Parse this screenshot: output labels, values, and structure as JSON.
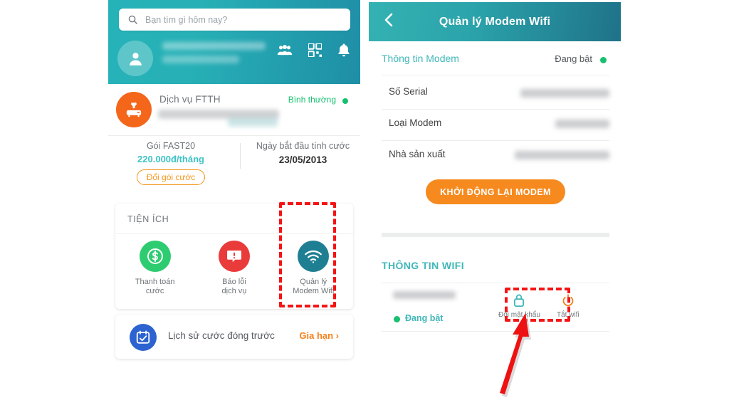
{
  "app": {
    "left_screen": {
      "search": {
        "placeholder": "Bạn tìm gì hôm nay?",
        "value": "",
        "icon": "search-icon"
      },
      "header_icons": [
        {
          "name": "friends-icon",
          "label": "Bạn bè"
        },
        {
          "name": "qr-code-icon",
          "label": "QR"
        },
        {
          "name": "bell-icon",
          "label": "Thông báo"
        }
      ],
      "service": {
        "icon": "modem-icon",
        "title": "Dịch vụ FTTH",
        "status": "Bình thường",
        "status_color": "#17c070"
      },
      "plan": {
        "name": "Gói FAST20",
        "price": "220.000đ/tháng",
        "change_plan_button": "Đổi gói cước",
        "billing_label": "Ngày bắt đầu tính cước",
        "billing_date": "23/05/2013"
      },
      "utilities": {
        "title": "TIỆN ÍCH",
        "items": [
          {
            "label": "Thanh toán\ncước",
            "line1": "Thanh toán",
            "line2": "cước",
            "icon": "dollar-icon",
            "color": "#2ecc71"
          },
          {
            "label": "Báo lỗi\ndịch vụ",
            "line1": "Báo lỗi",
            "line2": "dịch vụ",
            "icon": "report-error-icon",
            "color": "#ea3b3b"
          },
          {
            "label": "Quản lý\nModem Wifi",
            "line1": "Quản lý",
            "line2": "Modem Wifi",
            "icon": "wifi-icon",
            "color": "#1f7f92"
          }
        ]
      },
      "history": {
        "icon": "calendar-check-icon",
        "label": "Lịch sử cước đóng trước",
        "action": "Gia hạn ›",
        "action_color": "#f4801a"
      }
    },
    "right_screen": {
      "header": {
        "back_icon": "back-chevron-icon",
        "title": "Quản lý Modem Wifi"
      },
      "modem_section": {
        "title": "Thông tin Modem",
        "status": "Đang bật",
        "status_color": "#17c070",
        "rows": [
          {
            "label": "Số Serial",
            "value": ""
          },
          {
            "label": "Loại Modem",
            "value": ""
          },
          {
            "label": "Nhà sản xuất",
            "value": ""
          }
        ],
        "restart_button": "KHỞI ĐỘNG LẠI MODEM"
      },
      "wifi_section": {
        "title": "THÔNG TIN WIFI",
        "ssid": "",
        "state": "Đang bật",
        "state_color": "#17c070",
        "actions": [
          {
            "label": "Đổi mật khẩu",
            "icon": "lock-icon",
            "color": "#3fb7b9"
          },
          {
            "label": "Tắt wifi",
            "icon": "power-icon",
            "color": "#f0801a"
          }
        ]
      }
    },
    "annotations": {
      "highlight_color": "#f41414",
      "boxes": [
        {
          "name": "utility-wifi-highlight",
          "target": "Quản lý Modem Wifi"
        },
        {
          "name": "change-password-highlight",
          "target": "Đổi mật khẩu"
        }
      ],
      "arrow": {
        "name": "pointer-arrow",
        "points_to": "Đổi mật khẩu"
      }
    }
  }
}
